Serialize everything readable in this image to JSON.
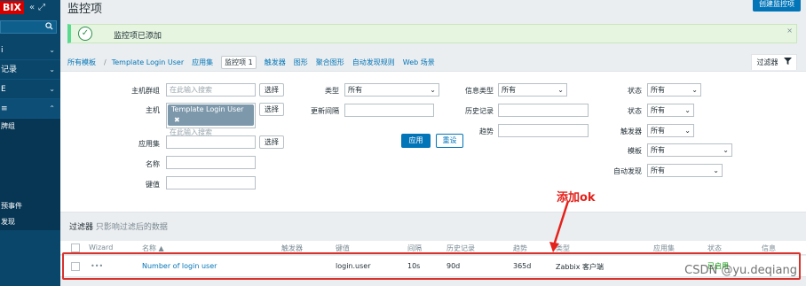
{
  "sidebar": {
    "logo": "BIX",
    "collapse_icon": "«",
    "expand_icon": "⤢",
    "items": [
      {
        "label": "i"
      },
      {
        "label": "记录"
      },
      {
        "label": "E"
      },
      {
        "label": "≡"
      },
      {
        "label": "牌组"
      },
      {
        "label": "预事件"
      },
      {
        "label": "发现"
      }
    ]
  },
  "header": {
    "title": "监控项",
    "create_button": "创建监控项"
  },
  "message": {
    "text": "监控项已添加",
    "close": "×"
  },
  "nav": {
    "breadcrumb_all": "所有模板",
    "breadcrumb_sep": "/",
    "breadcrumb_template": "Template Login User",
    "tabs": [
      "应用集",
      "监控项 1",
      "触发器",
      "图形",
      "聚合图形",
      "自动发现规则",
      "Web 场景"
    ],
    "filter_tab": "过滤器"
  },
  "filter": {
    "host_group_label": "主机群组",
    "host_group_placeholder": "在此输入搜索",
    "select_button": "选择",
    "host_label": "主机",
    "host_tag": "Template Login User",
    "host_tag_remove": "✖",
    "host_placeholder": "在此输入搜索",
    "app_label": "应用集",
    "name_label": "名称",
    "key_label": "键值",
    "type_label": "类型",
    "type_value": "所有",
    "interval_label": "更新间隔",
    "info_type_label": "信息类型",
    "info_type_value": "所有",
    "history_label": "历史记录",
    "trends_label": "趋势",
    "status_label": "状态",
    "status_value": "所有",
    "status2_label": "状态",
    "status2_value": "所有",
    "trigger_label": "触发器",
    "trigger_value": "所有",
    "template_label": "模板",
    "template_value": "所有",
    "discovery_label": "自动发现",
    "discovery_value": "所有",
    "apply_button": "应用",
    "reset_button": "重设"
  },
  "filter_note": {
    "title": "过滤器",
    "sub": "只影响过滤后的数据"
  },
  "table": {
    "headers": [
      "Wizard",
      "名称 ▲",
      "触发器",
      "键值",
      "间隔",
      "历史记录",
      "趋势",
      "类型",
      "应用集",
      "状态",
      "信息"
    ],
    "rows": [
      {
        "wizard": "•••",
        "name": "Number of login user",
        "key": "login.user",
        "interval": "10s",
        "history": "90d",
        "trends": "365d",
        "type": "Zabbix 客户端",
        "status": "已启用"
      }
    ]
  },
  "annotation": {
    "text": "添加ok",
    "color": "#e4221c"
  },
  "watermark": "CSDN @yu.deqiang"
}
